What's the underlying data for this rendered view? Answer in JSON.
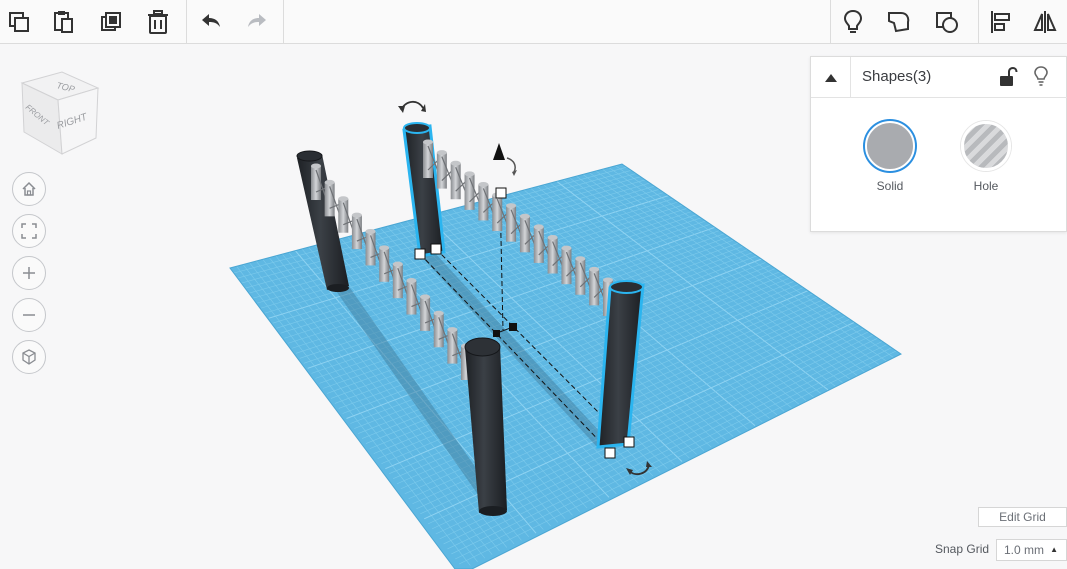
{
  "panel": {
    "title": "Shapes(3)",
    "options": [
      {
        "label": "Solid",
        "color": "#a9abaf"
      },
      {
        "label": "Hole"
      }
    ]
  },
  "viewcube": {
    "top": "TOP",
    "front": "FRONT",
    "right": "RIGHT"
  },
  "edit_grid": {
    "label": "Edit Grid"
  },
  "snap_grid": {
    "label": "Snap Grid",
    "value": "1.0 mm"
  },
  "colors": {
    "workplane": "#5fb8e3",
    "grid_line": "#7ccaec",
    "selection": "#2bb5f0",
    "cylinder": "#2f3338"
  },
  "toolbar_icons": [
    "copy-icon",
    "paste-icon",
    "duplicate-icon",
    "trash-icon",
    "undo-icon",
    "redo-icon",
    "lightbulb-icon",
    "shape-notes-icon",
    "group-icon",
    "align-icon",
    "mirror-icon"
  ]
}
